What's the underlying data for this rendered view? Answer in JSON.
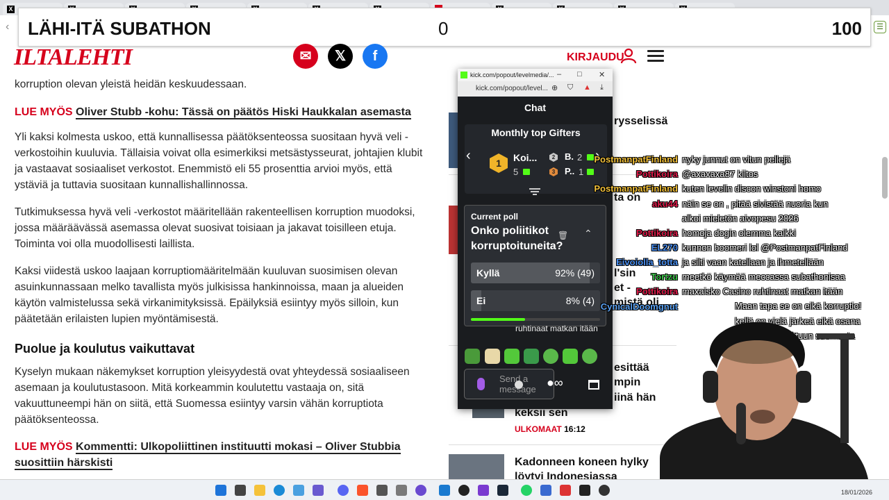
{
  "subathon": {
    "title": "LÄHI-ITÄ SUBATHON",
    "current": "0",
    "goal": "100"
  },
  "site": {
    "logo": "ILTALEHTI",
    "login_label": "KIRJAUDU",
    "social": [
      "mail-icon",
      "x-icon",
      "facebook-icon"
    ],
    "brand_color": "#d6001c"
  },
  "article": {
    "top_fragment": "korruption olevan yleistä heidän keskuudessaan.",
    "lue_myos_1": {
      "prefix": "LUE MYÖS",
      "link": "Oliver Stubb -kohu: Tässä on päätös Hiski Haukkalan asemasta"
    },
    "p1": "Yli kaksi kolmesta uskoo, että kunnallisessa päätöksenteossa suositaan hyvä veli -verkostoihin kuuluvia. Tällaisia voivat olla esimerkiksi metsästysseurat, johtajien klubit ja vastaavat sosiaaliset verkostot. Enemmistö eli 55 prosenttia arvioi myös, että ystäviä ja tuttavia suositaan kunnallishallinnossa.",
    "p2": "Tutkimuksessa hyvä veli -verkostot määritellään rakenteellisen korruption muodoksi, jossa määräävässä asemassa olevat suosivat toisiaan ja jakavat toisilleen etuja. Toiminta voi olla muodollisesti laillista.",
    "p3": "Kaksi viidestä uskoo laajaan korruptiomääritelmään kuuluvan suosimisen olevan asuinkunnassaan melko tavallista myös julkisissa hankinnoissa, maan ja alueiden käytön valmistelussa sekä virkanimityksissä. Epäilyksiä esiintyy myös silloin, kun päätetään erilaisten lupien myöntämisestä.",
    "heading": "Puolue ja koulutus vaikuttavat",
    "p4": "Kyselyn mukaan näkemykset korruption yleisyydestä ovat yhteydessä sosiaaliseen asemaan ja koulutustasoon. Mitä korkeammin koulutettu vastaaja on, sitä vakuuttuneempi hän on siitä, että Suomessa esiintyy varsin vähän korruptiota päätöksenteossa.",
    "lue_myos_2": {
      "prefix": "LUE MYÖS",
      "link": "Kommentti: Ulkopoliittinen instituutti mokasi – Oliver Stubbia suosittiin härskisti"
    }
  },
  "right_news": {
    "n1": "rysselissä",
    "n2": "ta on",
    "n3a": "l'sin",
    "n3b": "et -",
    "n3c": "mistä oli",
    "n4a": "esittää",
    "n4b": "mpin",
    "n4c": "iinä hän",
    "n4d": "keksii sen",
    "section": "ULKOMAAT",
    "time": "16:12",
    "n5a": "Kadonneen koneen hylky",
    "n5b": "löytyi Indonesiassa"
  },
  "popup": {
    "url_title": "kick.com/popout/levelmedia/...",
    "url": "kick.com/popout/level...",
    "chat_header": "Chat",
    "gifters_title": "Monthly top Gifters",
    "gifters": [
      {
        "rank": "1",
        "name": "Koi...",
        "count": "5"
      },
      {
        "rank": "2",
        "name": "B.",
        "count": "2"
      },
      {
        "rank": "3",
        "name": "P..",
        "count": "1"
      }
    ],
    "poll": {
      "label": "Current poll",
      "question": "Onko poliitikot korruptoituneita?",
      "options": [
        {
          "label": "Kyllä",
          "value": "92% (49)",
          "share": 0.92
        },
        {
          "label": "Ei",
          "value": "8% (4)",
          "share": 0.08
        }
      ],
      "remaining": 0.42
    },
    "chat_fragment": "ruhtinaat matkan itään",
    "send_placeholder": "Send a message",
    "kick_color": "#53fc18"
  },
  "stream_chat": [
    {
      "name": "PostmanpatFinland",
      "color": "#f3c13a",
      "msg": "nyky junnut on vitun pellejä"
    },
    {
      "name": "Pottikoira",
      "color": "#e01c4b",
      "msg": "@axaxaxa87 kiitos"
    },
    {
      "name": "PostmanpatFinland",
      "color": "#f3c13a",
      "msg": "kuten levelin discon winstoni homo"
    },
    {
      "name": "aku44",
      "color": "#e01c4b",
      "msg": "näin se on , pitää sivistää nuoria kun"
    },
    {
      "name": "",
      "color": "#ffffff",
      "msg": "alkoi mieletön aivopesu 2026"
    },
    {
      "name": "Pottikoira",
      "color": "#e01c4b",
      "msg": "homoja dogin olemma kaikki"
    },
    {
      "name": "EL270",
      "color": "#4a8ff0",
      "msg": "kunnon boomeri lol @PostmanpatFinland"
    },
    {
      "name": "Eivoiolla_totta",
      "color": "#4a8ff0",
      "msg": "ja silti vaan katellaan ja ihmetellään"
    },
    {
      "name": "Tortzu",
      "color": "#3cc64a",
      "msg": "meetkö käymää meccassa subathonisaa"
    },
    {
      "name": "Pottikoira",
      "color": "#e01c4b",
      "msg": "maxaisko Casino ruhtinaat matkan itään"
    },
    {
      "name": "CynicalDoomgnut",
      "color": "#5aa0f0",
      "msg": "Maan tapa se on eikä korruptio!"
    },
    {
      "name": "",
      "color": "#ffffff",
      "msg": "kellä on vielä järkeä eikä osana"
    },
    {
      "name": "",
      "color": "#ffffff",
      "msg": "tapaa laittee vittuun suomesta"
    }
  ],
  "taskbar": {
    "date": "18/01/2026"
  }
}
